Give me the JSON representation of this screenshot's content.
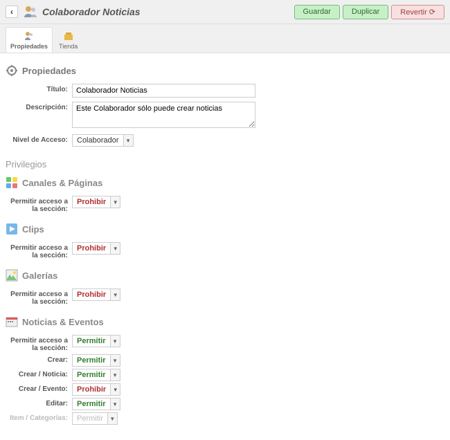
{
  "header": {
    "title": "Colaborador Noticias",
    "buttons": {
      "save": "Guardar",
      "duplicate": "Duplicar",
      "revert": "Revertir"
    }
  },
  "tabs": {
    "properties": "Propiedades",
    "store": "Tienda"
  },
  "sections": {
    "properties": {
      "title": "Propiedades",
      "rows": {
        "title": {
          "label": "Título:",
          "value": "Colaborador Noticias"
        },
        "description": {
          "label": "Descripción:",
          "value": "Este Colaborador sólo puede crear noticias"
        },
        "access": {
          "label": "Nivel de Acceso:",
          "value": "Colaborador"
        }
      }
    },
    "privileges_title": "Privilegios",
    "channels": {
      "title": "Canales & Páginas",
      "allow_label": "Permitir acceso a la sección:",
      "allow_value": "Prohibir"
    },
    "clips": {
      "title": "Clips",
      "allow_label": "Permitir acceso a la sección:",
      "allow_value": "Prohibir"
    },
    "galleries": {
      "title": "Galerías",
      "allow_label": "Permitir acceso a la sección:",
      "allow_value": "Prohibir"
    },
    "news": {
      "title": "Noticias & Eventos",
      "rows": {
        "allow": {
          "label": "Permitir acceso a la sección:",
          "value": "Permitir"
        },
        "create": {
          "label": "Crear:",
          "value": "Permitir"
        },
        "create_news": {
          "label": "Crear / Noticia:",
          "value": "Permitir"
        },
        "create_event": {
          "label": "Crear / Evento:",
          "value": "Prohibir"
        },
        "edit": {
          "label": "Editar:",
          "value": "Permitir"
        },
        "item_cat": {
          "label": "Item / Categorías:",
          "value": "Permitir"
        }
      }
    }
  }
}
